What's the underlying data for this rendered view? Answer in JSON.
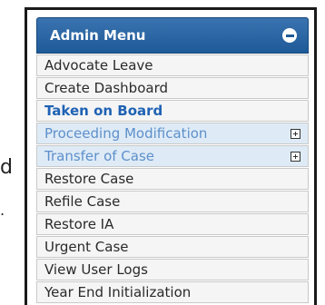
{
  "left_fragments": {
    "first": "d",
    "second": "."
  },
  "menu": {
    "title": "Admin Menu",
    "items": [
      {
        "label": "Advocate Leave"
      },
      {
        "label": "Create Dashboard"
      },
      {
        "label": "Taken on Board"
      },
      {
        "label": "Proceeding Modification"
      },
      {
        "label": "Transfer of Case"
      },
      {
        "label": "Restore Case"
      },
      {
        "label": "Refile Case"
      },
      {
        "label": "Restore IA"
      },
      {
        "label": "Urgent Case"
      },
      {
        "label": "View User Logs"
      },
      {
        "label": "Year End Initialization"
      }
    ]
  }
}
